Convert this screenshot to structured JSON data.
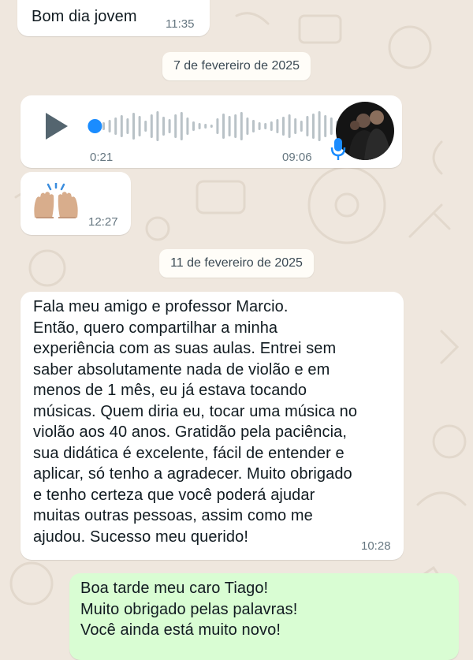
{
  "messages": {
    "m1": {
      "text": "Bom dia jovem",
      "time": "11:35"
    },
    "date1": "7 de fevereiro de 2025",
    "voice": {
      "elapsed": "0:21",
      "time": "09:06",
      "progress": 0.02
    },
    "emoji_msg": {
      "emoji": "raising-hands",
      "time": "12:27"
    },
    "date2": "11 de fevereiro de 2025",
    "m3": {
      "lines": [
        "Fala meu amigo e professor Marcio.",
        "Então, quero compartilhar a minha",
        "experiência com as suas aulas. Entrei sem",
        "saber absolutamente nada de violão e em",
        "menos de 1 mês, eu já estava tocando",
        "músicas. Quem diria eu, tocar uma música no",
        "violão aos 40 anos. Gratidão pela paciência,",
        "sua didática é excelente, fácil de entender e",
        "aplicar, só tenho a agradecer. Muito obrigado",
        "e tenho certeza que você poderá ajudar",
        "muitas outras pessoas, assim como me",
        "ajudou. Sucesso meu querido!"
      ],
      "time": "10:28"
    },
    "m4": {
      "lines": [
        "Boa tarde meu caro Tiago!",
        "Muito obrigado pelas palavras!",
        "Você ainda está muito novo!"
      ]
    }
  },
  "colors": {
    "background": "#efe7de",
    "incoming": "#ffffff",
    "outgoing": "#d9fdd3",
    "accent": "#1a8cff",
    "timestamp": "#667781"
  },
  "icons": [
    "play-icon",
    "microphone-icon",
    "raising-hands-emoji"
  ]
}
